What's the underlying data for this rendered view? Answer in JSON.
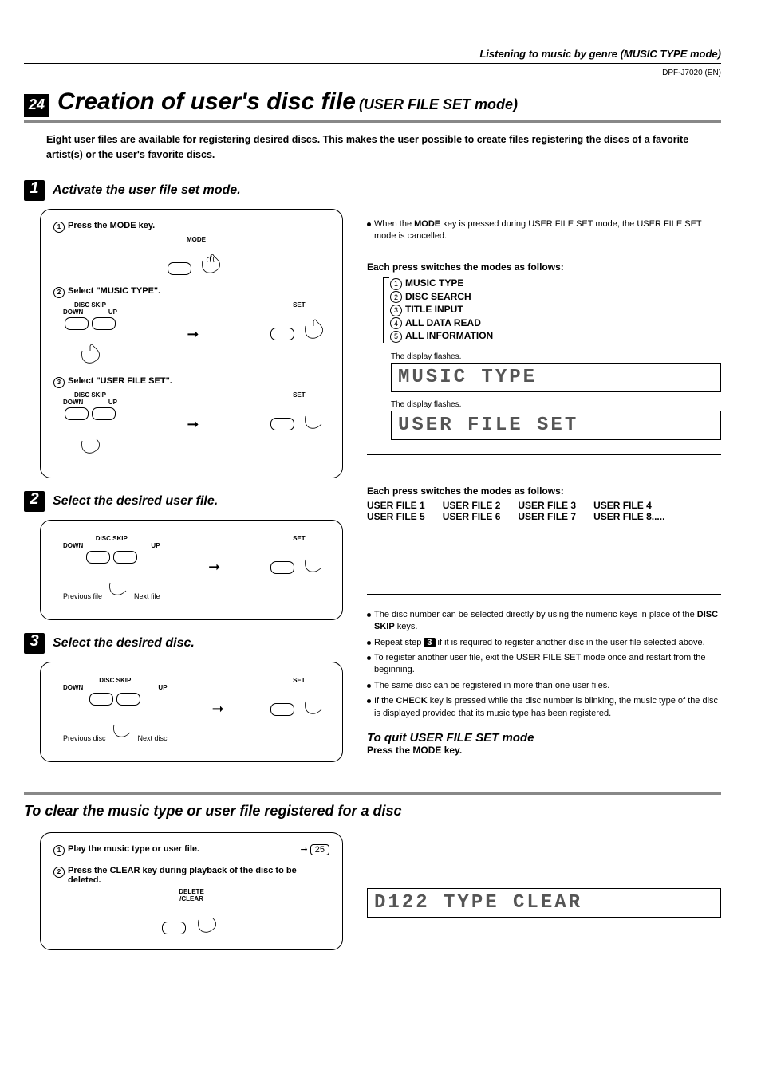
{
  "header": {
    "breadcrumb": "Listening to music by genre (MUSIC TYPE mode)",
    "model": "DPF-J7020 (EN)"
  },
  "pageNumber": "24",
  "title": "Creation of user's disc file",
  "subtitle": "(USER FILE SET mode)",
  "intro": "Eight user files are available for registering desired discs. This makes the user possible to create files registering the discs of a favorite artist(s) or the user's favorite discs.",
  "steps": {
    "s1": {
      "num": "1",
      "title": "Activate the user file set mode.",
      "sub1": "Press the MODE key.",
      "sub2": "Select \"MUSIC TYPE\".",
      "sub3": "Select \"USER FILE SET\".",
      "labels": {
        "mode": "MODE",
        "discSkip": "DISC SKIP",
        "down": "DOWN",
        "up": "UP",
        "set": "SET"
      }
    },
    "s2": {
      "num": "2",
      "title": "Select the desired user file.",
      "prev": "Previous file",
      "next": "Next file"
    },
    "s3": {
      "num": "3",
      "title": "Select the desired disc.",
      "prev": "Previous disc",
      "next": "Next disc"
    }
  },
  "right": {
    "note1a": "When the ",
    "note1b": "MODE",
    "note1c": " key is pressed during USER FILE SET mode, the USER FILE SET mode is cancelled.",
    "switchHeader": "Each press switches the modes as follows:",
    "modes": {
      "m1": "MUSIC TYPE",
      "m2": "DISC SEARCH",
      "m3": "TITLE INPUT",
      "m4": "ALL DATA READ",
      "m5": "ALL INFORMATION"
    },
    "dispFlash": "The display flashes.",
    "disp1": "MUSIC TYPE",
    "disp2": "USER FILE SET",
    "files": {
      "f1": "USER FILE 1",
      "f2": "USER FILE 2",
      "f3": "USER FILE 3",
      "f4": "USER FILE 4",
      "f5": "USER FILE 5",
      "f6": "USER FILE 6",
      "f7": "USER FILE 7",
      "f8": "USER FILE 8....."
    },
    "s3notes": {
      "n1a": "The disc number can be selected directly by using the numeric keys in place of the ",
      "n1b": "DISC SKIP",
      "n1c": " keys.",
      "n2a": "Repeat step ",
      "n2b": "3",
      "n2c": " if it is required to register another disc in the user file selected above.",
      "n3": "To register another user file, exit the USER FILE SET mode once and restart from the beginning.",
      "n4": "The same disc can be registered in more than one user files.",
      "n5a": "If the ",
      "n5b": "CHECK",
      "n5c": " key is pressed while the disc number is blinking, the music type of the disc is displayed provided that its music type has been registered."
    },
    "quitTitle": "To quit USER FILE SET mode",
    "quitSub": "Press the MODE key."
  },
  "clear": {
    "title": "To clear the music type or user file registered for a disc",
    "sub1": "Play the music type or user file.",
    "ref": "25",
    "sub2": "Press the CLEAR key during playback of the disc to be deleted.",
    "keyLabel": "DELETE\n/CLEAR",
    "disp": "D122 TYPE CLEAR"
  }
}
